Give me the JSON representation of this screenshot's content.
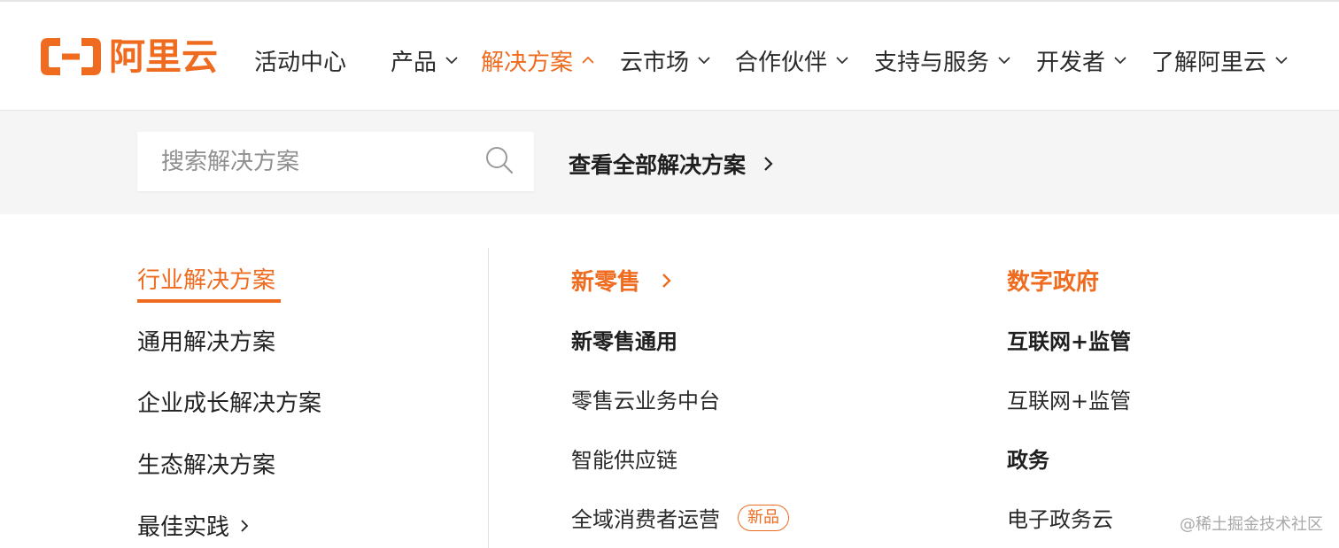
{
  "brand": {
    "logo_text": "阿里云",
    "accent_color": "#ee6b1f"
  },
  "nav": {
    "items": [
      {
        "label": "活动中心",
        "has_dropdown": false,
        "active": false
      },
      {
        "label": "产品",
        "has_dropdown": true,
        "active": false
      },
      {
        "label": "解决方案",
        "has_dropdown": true,
        "active": true
      },
      {
        "label": "云市场",
        "has_dropdown": true,
        "active": false
      },
      {
        "label": "合作伙伴",
        "has_dropdown": true,
        "active": false
      },
      {
        "label": "支持与服务",
        "has_dropdown": true,
        "active": false
      },
      {
        "label": "开发者",
        "has_dropdown": true,
        "active": false
      },
      {
        "label": "了解阿里云",
        "has_dropdown": true,
        "active": false
      }
    ]
  },
  "search": {
    "placeholder": "搜索解决方案",
    "value": "",
    "icon": "search-icon"
  },
  "view_all_label": "查看全部解决方案",
  "side_menu": {
    "items": [
      {
        "label": "行业解决方案",
        "active": true
      },
      {
        "label": "通用解决方案",
        "active": false
      },
      {
        "label": "企业成长解决方案",
        "active": false
      },
      {
        "label": "生态解决方案",
        "active": false
      },
      {
        "label": "最佳实践",
        "active": false
      }
    ]
  },
  "columns": {
    "retail": {
      "title": "新零售",
      "sub_heading": "新零售通用",
      "links": [
        {
          "label": "零售云业务中台"
        },
        {
          "label": "智能供应链"
        },
        {
          "label": "全域消费者运营",
          "badge": "新品"
        }
      ]
    },
    "gov": {
      "title": "数字政府",
      "groups": [
        {
          "heading": "互联网+监管",
          "links": [
            "互联网+监管"
          ]
        },
        {
          "heading": "政务",
          "links": [
            "电子政务云"
          ]
        }
      ]
    }
  },
  "watermark": "@稀土掘金技术社区"
}
